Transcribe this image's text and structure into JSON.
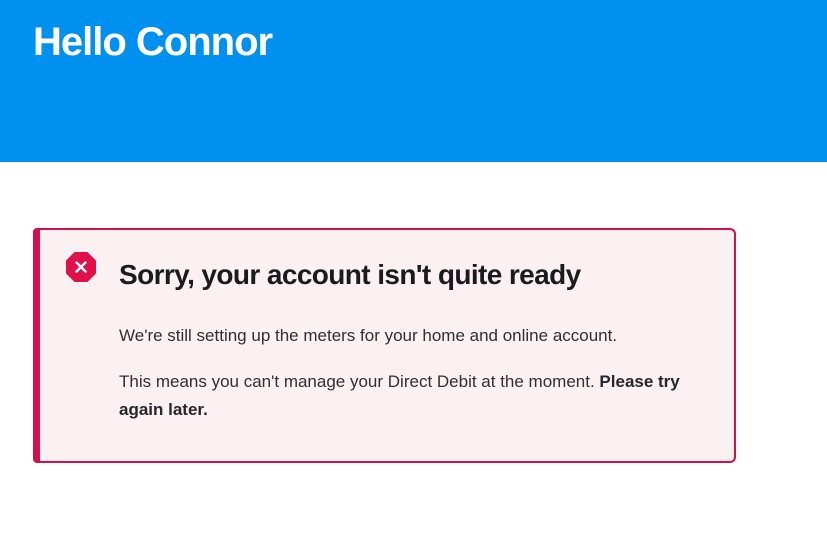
{
  "header": {
    "greeting": "Hello Connor"
  },
  "alert": {
    "icon": "error-close-icon",
    "title": "Sorry, your account isn't quite ready",
    "message_1": "We're still setting up the meters for your home and online account.",
    "message_2_plain": "This means you can't manage your Direct Debit at the moment. ",
    "message_2_bold": "Please try again later."
  },
  "colors": {
    "header_bg": "#0091f0",
    "alert_border": "#d2104b",
    "alert_bg": "#fbf0f2",
    "text_dark": "#1b1b1f"
  }
}
